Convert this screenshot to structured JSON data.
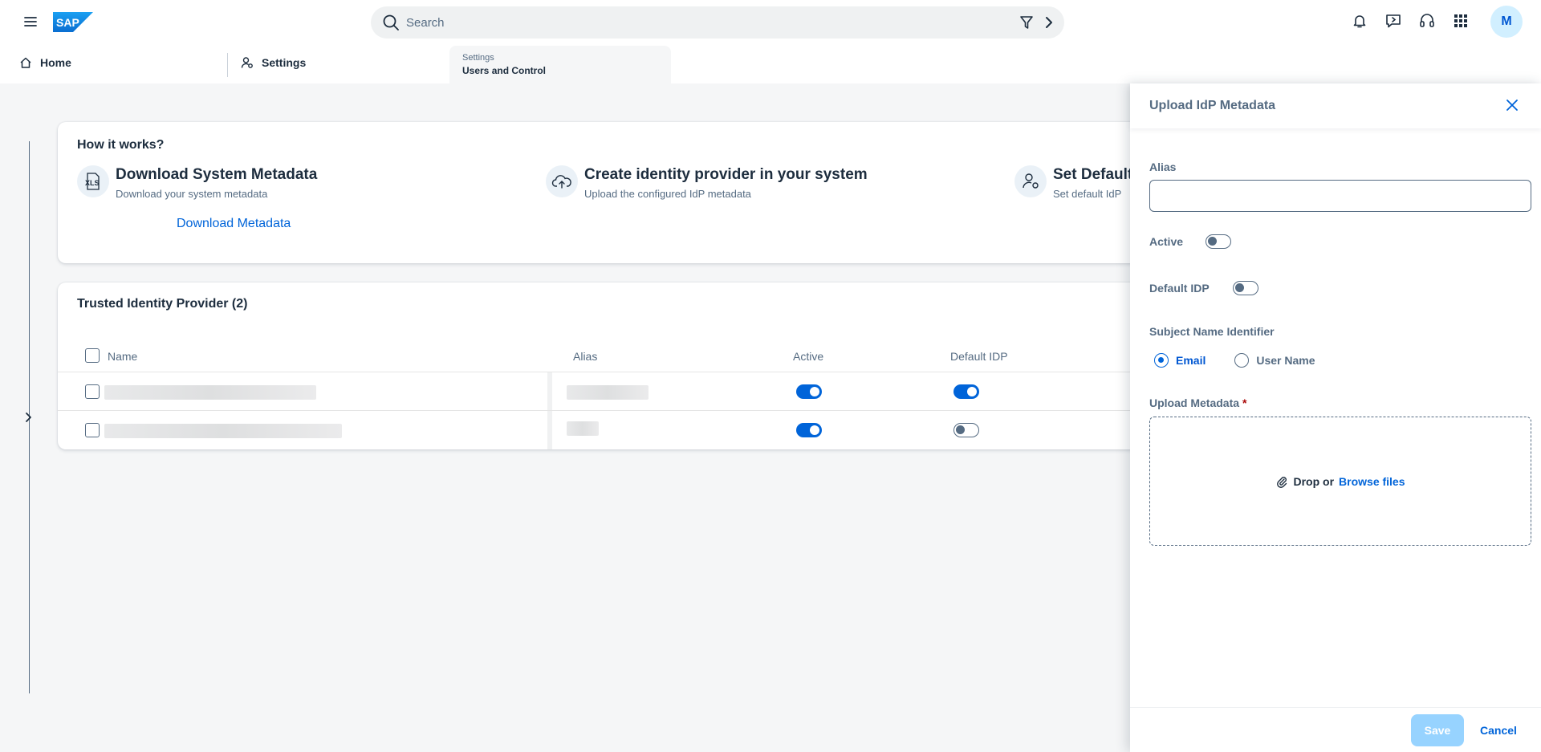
{
  "shell": {
    "logo": "SAP",
    "search_placeholder": "Search",
    "avatar_initial": "M",
    "icons": [
      "menu-icon",
      "search-icon",
      "filter-icon",
      "chevron-right-icon",
      "bell-icon",
      "feedback-icon",
      "headset-icon",
      "grid-icon"
    ]
  },
  "tabs": {
    "home_label": "Home",
    "settings_label": "Settings",
    "active_small": "Settings",
    "active_main": "Users and Control"
  },
  "how_it_works": {
    "title": "How it works?",
    "steps": [
      {
        "title": "Download System Metadata",
        "subtitle": "Download your system metadata",
        "icon": "xls-icon"
      },
      {
        "title": "Create identity provider in your system",
        "subtitle": "Upload the configured IdP metadata",
        "icon": "cloud-upload-icon"
      },
      {
        "title": "Set Default",
        "subtitle": "Set default IdP",
        "icon": "user-settings-icon"
      }
    ],
    "download_link": "Download Metadata"
  },
  "trusted_idp": {
    "title": "Trusted Identity Provider (2)",
    "columns": {
      "name": "Name",
      "alias": "Alias",
      "active": "Active",
      "default": "Default IDP"
    },
    "rows": [
      {
        "active": true,
        "default": true
      },
      {
        "active": true,
        "default": false
      }
    ]
  },
  "dialog": {
    "title": "Upload IdP Metadata",
    "alias_label": "Alias",
    "alias_value": "",
    "active_label": "Active",
    "active_on": false,
    "default_label": "Default IDP",
    "default_on": false,
    "subject_label": "Subject Name Identifier",
    "radio_email": "Email",
    "radio_username": "User Name",
    "selected": "Email",
    "upload_label": "Upload Metadata",
    "required_mark": "*",
    "drop_text": "Drop or",
    "browse_text": "Browse files",
    "save_label": "Save",
    "cancel_label": "Cancel"
  },
  "colors": {
    "accent": "#0064d9",
    "text": "#1d2d3e",
    "muted": "#556b82",
    "save_disabled": "#97d3ff"
  }
}
